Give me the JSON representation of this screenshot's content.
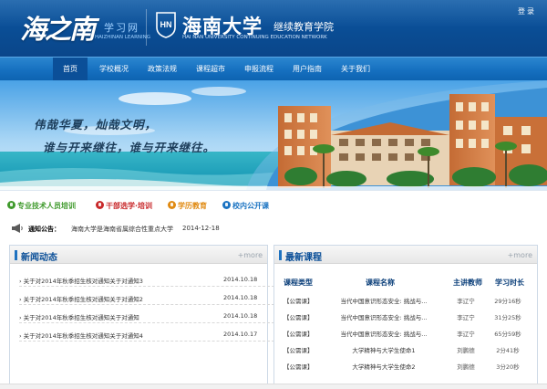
{
  "header": {
    "logo_big": "海之南",
    "logo_cn": "学习网",
    "logo_en": "HAIZHINAN LEARNING",
    "emblem_text": "HN",
    "univ_title": "海南大学",
    "college_name": "继续教育学院",
    "college_en": "HAI NAN UNIVERSITY CONTINUING EDUCATION NETWORK",
    "login": "登录",
    "colors": {
      "bg": "#0a4c93",
      "nav": "#1670c0",
      "active": "#0b4f98"
    }
  },
  "nav": {
    "items": [
      {
        "label": "首页",
        "active": true
      },
      {
        "label": "学校概况",
        "active": false
      },
      {
        "label": "政策法规",
        "active": false
      },
      {
        "label": "课程超市",
        "active": false
      },
      {
        "label": "申报流程",
        "active": false
      },
      {
        "label": "用户指南",
        "active": false
      },
      {
        "label": "关于我们",
        "active": false
      }
    ]
  },
  "banner": {
    "line1": "伟哉华夏，灿哉文明，",
    "line2": "谁与开来继往，谁与开来继往。"
  },
  "quicklinks": [
    {
      "label": "专业技术人员培训",
      "color": "#3f9a2c",
      "icon": "leaf-icon"
    },
    {
      "label": "干部选学·培训",
      "color": "#c8282a",
      "icon": "flag-icon"
    },
    {
      "label": "学历教育",
      "color": "#e08a12",
      "icon": "book-icon"
    },
    {
      "label": "校内公开课",
      "color": "#1a73c2",
      "icon": "chat-icon"
    }
  ],
  "notice": {
    "label": "通知公告：",
    "text": "海南大学是海南省属综合性重点大学",
    "date": "2014-12-18"
  },
  "news": {
    "title": "新闻动态",
    "more": "+more",
    "items": [
      {
        "title": "关于对2014年秋季招生核对通知关于对通知3",
        "date": "2014.10.18"
      },
      {
        "title": "关于对2014年秋季招生核对通知关于对通知2",
        "date": "2014.10.18"
      },
      {
        "title": "关于对2014年秋季招生核对通知关于对通知",
        "date": "2014.10.18"
      },
      {
        "title": "关于对2014年秋季招生核对通知关于对通知4",
        "date": "2014.10.17"
      }
    ]
  },
  "courses": {
    "title": "最新课程",
    "more": "+more",
    "headers": {
      "type": "课程类型",
      "name": "课程名称",
      "teacher": "主讲教师",
      "duration": "学习时长"
    },
    "rows": [
      {
        "type": "【公需课】",
        "name": "当代中国意识形态安全: 挑战与...",
        "teacher": "李辽宁",
        "duration": "29分16秒"
      },
      {
        "type": "【公需课】",
        "name": "当代中国意识形态安全: 挑战与...",
        "teacher": "李辽宁",
        "duration": "31分25秒"
      },
      {
        "type": "【公需课】",
        "name": "当代中国意识形态安全: 挑战与...",
        "teacher": "李辽宁",
        "duration": "65分59秒"
      },
      {
        "type": "【公需课】",
        "name": "大学精神与大学生使命1",
        "teacher": "刘鹏德",
        "duration": "2分41秒"
      },
      {
        "type": "【公需课】",
        "name": "大学精神与大学生使命2",
        "teacher": "刘鹏德",
        "duration": "3分20秒"
      }
    ]
  }
}
